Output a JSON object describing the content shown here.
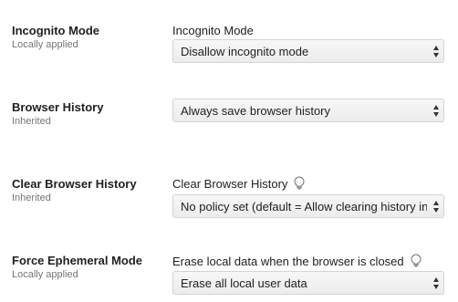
{
  "policies": [
    {
      "name": "Incognito Mode",
      "source": "Locally applied",
      "control_label": "Incognito Mode",
      "has_help_icon": false,
      "selected_value": "Disallow incognito mode"
    },
    {
      "name": "Browser History",
      "source": "Inherited",
      "control_label": "",
      "has_help_icon": false,
      "selected_value": "Always save browser history"
    },
    {
      "name": "Clear Browser History",
      "source": "Inherited",
      "control_label": "Clear Browser History",
      "has_help_icon": true,
      "selected_value": "No policy set (default = Allow clearing history in"
    },
    {
      "name": "Force Ephemeral Mode",
      "source": "Locally applied",
      "control_label": "Erase local data when the browser is closed",
      "has_help_icon": true,
      "selected_value": "Erase all local user data"
    }
  ],
  "icons": {
    "help": "lightbulb-icon",
    "select_arrows": "up-down-arrows-icon"
  },
  "colors": {
    "text": "#212121",
    "secondary_text": "#757575",
    "select_border": "#d4d4d4"
  }
}
